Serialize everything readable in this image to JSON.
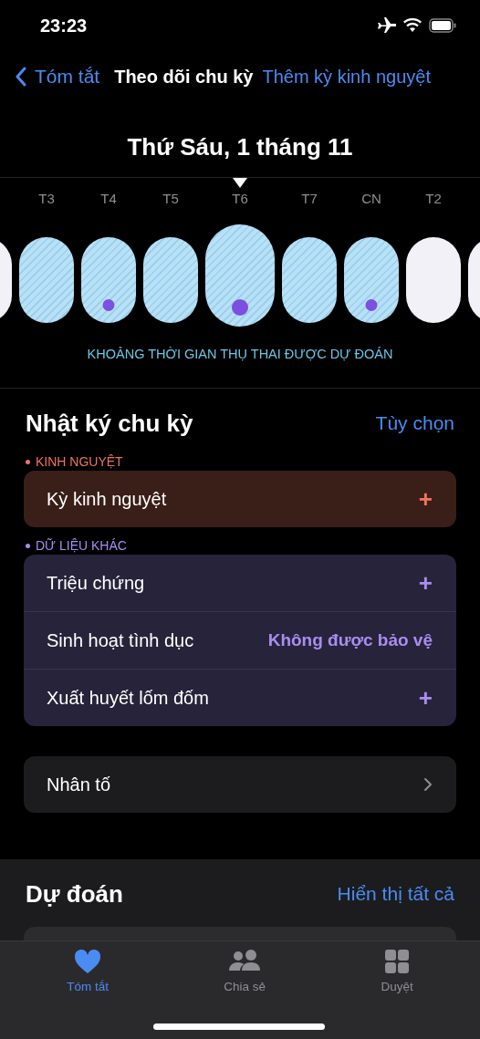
{
  "status_bar": {
    "time": "23:23"
  },
  "nav": {
    "back": "Tóm tắt",
    "title": "Theo dõi chu kỳ",
    "action": "Thêm kỳ kinh nguyệt"
  },
  "date_title": "Thứ Sáu, 1 tháng 11",
  "days": [
    {
      "kind": "plain",
      "selected": false
    },
    {
      "label": "T3",
      "kind": "fertile",
      "selected": false,
      "logged": false
    },
    {
      "label": "T4",
      "kind": "fertile",
      "selected": false,
      "logged": true
    },
    {
      "label": "T5",
      "kind": "fertile",
      "selected": false,
      "logged": false
    },
    {
      "label": "T6",
      "kind": "fertile",
      "selected": true,
      "logged": true
    },
    {
      "label": "T7",
      "kind": "fertile",
      "selected": false,
      "logged": false
    },
    {
      "label": "CN",
      "kind": "fertile",
      "selected": false,
      "logged": true
    },
    {
      "label": "T2",
      "kind": "plain",
      "selected": false,
      "logged": false
    },
    {
      "kind": "plain",
      "selected": false
    }
  ],
  "legend": "KHOẢNG THỜI GIAN THỤ THAI ĐƯỢC DỰ ĐOÁN",
  "log": {
    "title": "Nhật ký chu kỳ",
    "action": "Tùy chọn",
    "groups": [
      {
        "heading": "KINH NGUYỆT",
        "kind": "period",
        "rows": [
          {
            "label": "Kỳ kinh nguyệt",
            "kind": "add",
            "value": "+"
          }
        ]
      },
      {
        "heading": "DỮ LIỆU KHÁC",
        "kind": "other",
        "rows": [
          {
            "label": "Triệu chứng",
            "kind": "add",
            "value": "+"
          },
          {
            "label": "Sinh hoạt tình dục",
            "kind": "value",
            "value": "Không được bảo vệ"
          },
          {
            "label": "Xuất huyết lốm đốm",
            "kind": "add",
            "value": "+"
          }
        ]
      }
    ],
    "factors": "Nhân tố"
  },
  "predictions": {
    "title": "Dự đoán",
    "action": "Hiển thị tất cả"
  },
  "tab_bar": [
    {
      "label": "Tóm tắt",
      "selected": true
    },
    {
      "label": "Chia sẻ",
      "selected": false
    },
    {
      "label": "Duyệt",
      "selected": false
    }
  ]
}
